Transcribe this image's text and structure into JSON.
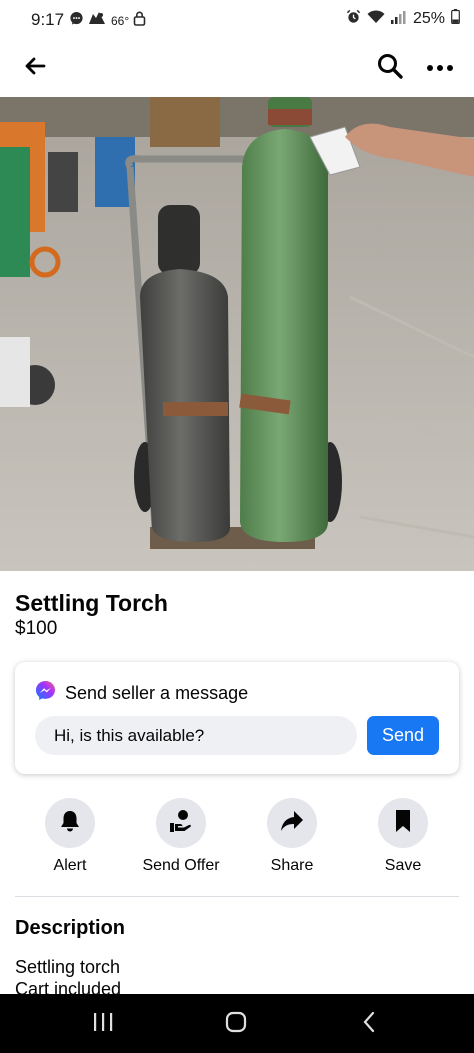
{
  "status_bar": {
    "time": "9:17",
    "temperature": "66°",
    "battery": "25%"
  },
  "nav": {
    "back_icon": "arrow-left-icon",
    "search_icon": "search-icon",
    "more_icon": "more-horizontal-icon"
  },
  "listing": {
    "title": "Settling Torch",
    "price": "$100"
  },
  "message": {
    "header": "Send seller a message",
    "input_value": "Hi, is this available?",
    "send_label": "Send"
  },
  "actions": [
    {
      "label": "Alert",
      "icon": "bell-icon"
    },
    {
      "label": "Send Offer",
      "icon": "send-offer-icon"
    },
    {
      "label": "Share",
      "icon": "share-icon"
    },
    {
      "label": "Save",
      "icon": "bookmark-icon"
    }
  ],
  "description": {
    "heading": "Description",
    "lines": [
      "Settling torch",
      "Cart included"
    ]
  },
  "colors": {
    "accent": "#1877f2",
    "action_bg": "#e4e6eb",
    "input_bg": "#eef0f3"
  }
}
